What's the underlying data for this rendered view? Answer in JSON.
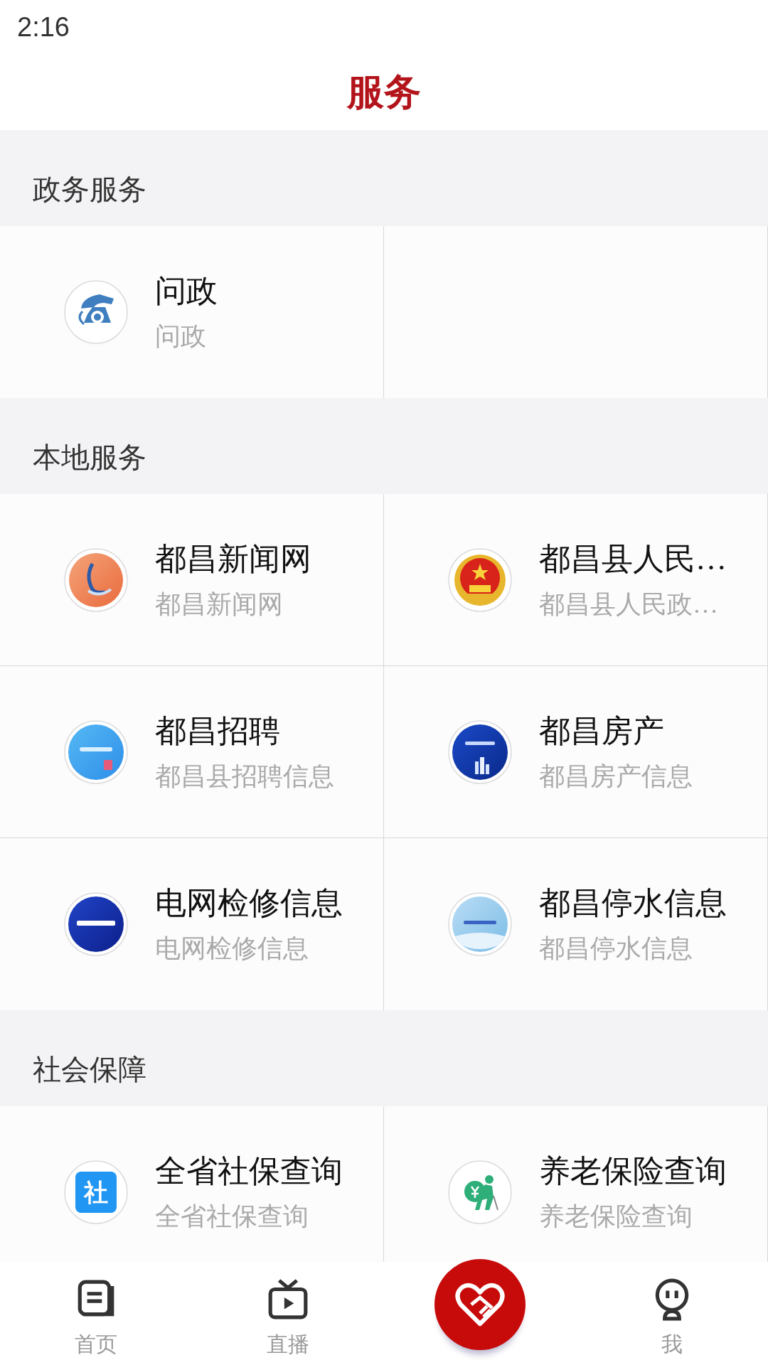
{
  "status_bar": {
    "time": "2:16"
  },
  "header": {
    "title": "服务"
  },
  "sections": [
    {
      "title": "政务服务",
      "tiles": [
        {
          "kind": "phone",
          "title": "问政",
          "subtitle": "问政"
        }
      ]
    },
    {
      "title": "本地服务",
      "tiles": [
        {
          "kind": "swoosh",
          "title": "都昌新闻网",
          "subtitle": "都昌新闻网"
        },
        {
          "kind": "emblem",
          "title": "都昌县人民…",
          "subtitle": "都昌县人民政…"
        },
        {
          "kind": "sky",
          "title": "都昌招聘",
          "subtitle": "都昌县招聘信息"
        },
        {
          "kind": "night",
          "title": "都昌房产",
          "subtitle": "都昌房产信息"
        },
        {
          "kind": "navy",
          "title": "电网检修信息",
          "subtitle": "电网检修信息"
        },
        {
          "kind": "pale",
          "title": "都昌停水信息",
          "subtitle": "都昌停水信息"
        }
      ]
    },
    {
      "title": "社会保障",
      "tiles": [
        {
          "kind": "badge",
          "icon_text": "社",
          "title": "全省社保查询",
          "subtitle": "全省社保查询"
        },
        {
          "kind": "elder",
          "title": "养老保险查询",
          "subtitle": "养老保险查询"
        }
      ]
    }
  ],
  "bottom_nav": [
    {
      "kind": "news",
      "label": "首页"
    },
    {
      "kind": "tv",
      "label": "直播"
    },
    {
      "kind": "heart"
    },
    {
      "kind": "robot",
      "label": "我"
    }
  ]
}
